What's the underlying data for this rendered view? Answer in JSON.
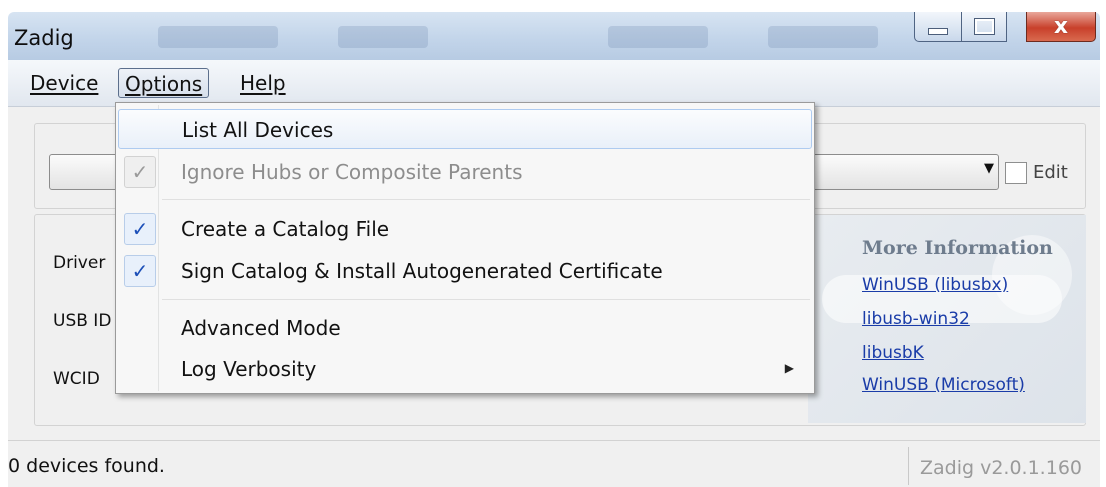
{
  "window": {
    "title": "Zadig",
    "minimize_icon": "minimize-icon",
    "maximize_icon": "maximize-icon",
    "close_icon": "close-icon",
    "close_glyph": "x"
  },
  "menubar": {
    "device": "Device",
    "options": "Options",
    "help": "Help"
  },
  "options_menu": {
    "items": [
      {
        "label": "List All Devices",
        "checked": false,
        "enabled": true,
        "highlighted": true
      },
      {
        "label": "Ignore Hubs or Composite Parents",
        "checked": true,
        "enabled": false
      },
      {
        "label": "Create a Catalog File",
        "checked": true,
        "enabled": true
      },
      {
        "label": "Sign Catalog & Install Autogenerated Certificate",
        "checked": true,
        "enabled": true
      },
      {
        "label": "Advanced Mode",
        "checked": false,
        "enabled": true
      },
      {
        "label": "Log Verbosity",
        "checked": false,
        "enabled": true,
        "submenu": true
      }
    ],
    "check_glyph": "✓"
  },
  "device_selector": {
    "value": "",
    "edit_label": "Edit",
    "edit_checked": false
  },
  "fields": {
    "driver_label": "Driver",
    "usb_id_label": "USB ID",
    "wcid_label": "WCID"
  },
  "more_info": {
    "title": "More Information",
    "links": [
      "WinUSB (libusbx)",
      "libusb-win32",
      "libusbK",
      "WinUSB (Microsoft)"
    ]
  },
  "status": {
    "text": "0 devices found.",
    "version": "Zadig v2.0.1.160"
  },
  "colors": {
    "link": "#1a3ca8",
    "check": "#1c4fb8",
    "menu_highlight_border": "#aecbf0"
  }
}
